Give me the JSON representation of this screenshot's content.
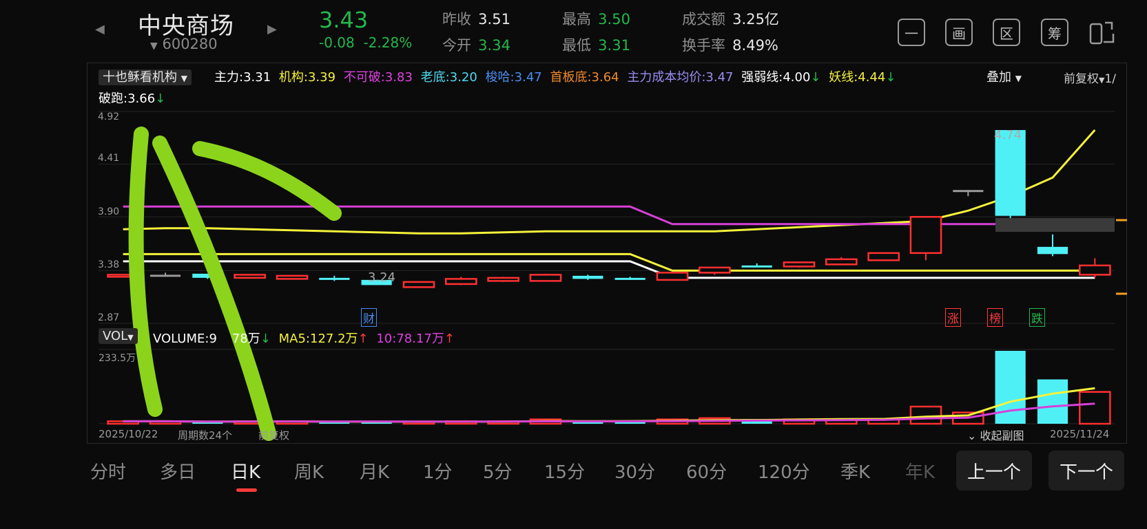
{
  "header": {
    "name": "中央商场",
    "code": "600280",
    "price": "3.43",
    "change": "-0.08",
    "change_pct": "-2.28%",
    "stats": [
      {
        "label": "昨收",
        "value": "3.51",
        "tone": "w"
      },
      {
        "label": "今开",
        "value": "3.34",
        "tone": "g"
      },
      {
        "label": "最高",
        "value": "3.50",
        "tone": "g"
      },
      {
        "label": "最低",
        "value": "3.31",
        "tone": "g"
      },
      {
        "label": "成交额",
        "value": "3.25亿",
        "tone": "w"
      },
      {
        "label": "换手率",
        "value": "8.49%",
        "tone": "w"
      }
    ],
    "tools": [
      "一",
      "画",
      "区",
      "筹"
    ]
  },
  "indicator": {
    "selector": "十也稣看机构",
    "items": [
      {
        "label": "主力:",
        "value": "3.31",
        "color": "#ffffff"
      },
      {
        "label": "机构:",
        "value": "3.39",
        "color": "#f5f23a"
      },
      {
        "label": "不可破:",
        "value": "3.83",
        "color": "#e040e0"
      },
      {
        "label": "老底:",
        "value": "3.20",
        "color": "#4fd9f0"
      },
      {
        "label": "梭哈:",
        "value": "3.47",
        "color": "#4b8df0"
      },
      {
        "label": "首板底:",
        "value": "3.64",
        "color": "#f08a2a"
      },
      {
        "label": "主力成本均价:",
        "value": "3.47",
        "color": "#9a8cf0"
      },
      {
        "label": "强弱线:",
        "value": "4.00",
        "color": "#ffffff"
      },
      {
        "label": "妖线:",
        "value": "4.44",
        "color": "#f5f23a"
      }
    ],
    "line2_label": "破跑:",
    "line2_value": "3.66",
    "overlay": "叠加",
    "adjust": "前复权",
    "page": "1/"
  },
  "price_axis": [
    "4.92",
    "4.41",
    "3.90",
    "3.38",
    "2.87"
  ],
  "annotations": {
    "low": "3.24",
    "high": "4.74",
    "fin": "财",
    "zt": "涨",
    "bang": "榜",
    "die": "跌"
  },
  "volume": {
    "selector": "VOL",
    "label": "VOLUME:",
    "value": "9",
    "value_suffix": "78万",
    "ma5": "MA5:127.2万",
    "ma10": "10:78.17万",
    "axis_top": "233.5万"
  },
  "footer": {
    "start": "2025/10/22",
    "periods": "周期数24个",
    "adjust": "前复权",
    "collapse": "收起副图",
    "end": "2025/11/24"
  },
  "tabs": [
    "分时",
    "多日",
    "日K",
    "周K",
    "月K",
    "1分",
    "5分",
    "15分",
    "30分",
    "60分",
    "120分",
    "季K",
    "年K"
  ],
  "active_tab": "日K",
  "nav": {
    "prev": "上一个",
    "next": "下一个"
  },
  "chart_data": {
    "type": "candlestick",
    "dates": [
      "2025/10/22",
      "",
      "",
      "",
      "",
      "",
      "",
      "",
      "",
      "",
      "",
      "",
      "",
      "",
      "",
      "",
      "",
      "",
      "",
      "",
      "",
      "",
      "",
      "2025/11/24"
    ],
    "candles": [
      {
        "o": 3.34,
        "c": 3.34,
        "h": 3.34,
        "l": 3.34,
        "dir": "up"
      },
      {
        "o": 3.34,
        "c": 3.34,
        "h": 3.36,
        "l": 3.32,
        "dir": "flat"
      },
      {
        "o": 3.35,
        "c": 3.31,
        "h": 3.35,
        "l": 3.3,
        "dir": "down"
      },
      {
        "o": 3.31,
        "c": 3.34,
        "h": 3.34,
        "l": 3.31,
        "dir": "up"
      },
      {
        "o": 3.3,
        "c": 3.33,
        "h": 3.33,
        "l": 3.3,
        "dir": "up"
      },
      {
        "o": 3.31,
        "c": 3.3,
        "h": 3.33,
        "l": 3.28,
        "dir": "down"
      },
      {
        "o": 3.29,
        "c": 3.24,
        "h": 3.29,
        "l": 3.24,
        "dir": "down"
      },
      {
        "o": 3.22,
        "c": 3.27,
        "h": 3.27,
        "l": 3.22,
        "dir": "up"
      },
      {
        "o": 3.25,
        "c": 3.3,
        "h": 3.32,
        "l": 3.24,
        "dir": "up"
      },
      {
        "o": 3.28,
        "c": 3.31,
        "h": 3.32,
        "l": 3.27,
        "dir": "up"
      },
      {
        "o": 3.28,
        "c": 3.34,
        "h": 3.35,
        "l": 3.28,
        "dir": "up"
      },
      {
        "o": 3.33,
        "c": 3.3,
        "h": 3.34,
        "l": 3.29,
        "dir": "down"
      },
      {
        "o": 3.31,
        "c": 3.3,
        "h": 3.32,
        "l": 3.29,
        "dir": "down"
      },
      {
        "o": 3.29,
        "c": 3.36,
        "h": 3.36,
        "l": 3.29,
        "dir": "up"
      },
      {
        "o": 3.36,
        "c": 3.41,
        "h": 3.41,
        "l": 3.34,
        "dir": "up"
      },
      {
        "o": 3.42,
        "c": 3.43,
        "h": 3.45,
        "l": 3.41,
        "dir": "down"
      },
      {
        "o": 3.42,
        "c": 3.46,
        "h": 3.46,
        "l": 3.41,
        "dir": "up"
      },
      {
        "o": 3.44,
        "c": 3.49,
        "h": 3.51,
        "l": 3.44,
        "dir": "up"
      },
      {
        "o": 3.48,
        "c": 3.55,
        "h": 3.55,
        "l": 3.48,
        "dir": "up"
      },
      {
        "o": 3.55,
        "c": 3.9,
        "h": 3.9,
        "l": 3.48,
        "dir": "up"
      },
      {
        "o": 4.16,
        "c": 4.16,
        "h": 4.16,
        "l": 4.1,
        "dir": "flat"
      },
      {
        "o": 4.74,
        "c": 3.91,
        "h": 4.74,
        "l": 3.88,
        "dir": "down"
      },
      {
        "o": 3.61,
        "c": 3.54,
        "h": 3.73,
        "l": 3.52,
        "dir": "down"
      },
      {
        "o": 3.34,
        "c": 3.43,
        "h": 3.5,
        "l": 3.31,
        "dir": "up"
      }
    ],
    "volume": [
      8,
      8,
      5,
      8,
      8,
      5,
      8,
      5,
      8,
      8,
      14,
      6,
      6,
      14,
      18,
      15,
      14,
      14,
      15,
      55,
      36,
      233.5,
      142,
      102
    ],
    "ylim": [
      2.87,
      4.92
    ],
    "lines": {
      "机构": [
        3.78,
        3.79,
        3.79,
        3.78,
        3.77,
        3.76,
        3.75,
        3.74,
        3.74,
        3.75,
        3.76,
        3.76,
        3.76,
        3.76,
        3.76,
        3.78,
        3.8,
        3.82,
        3.84,
        3.86,
        3.96,
        4.1,
        4.28,
        4.74
      ],
      "不可破": [
        4.0,
        4.0,
        4.0,
        4.0,
        4.0,
        4.0,
        4.0,
        4.0,
        4.0,
        4.0,
        4.0,
        4.0,
        4.0,
        3.83,
        3.83,
        3.83,
        3.83,
        3.83,
        3.83,
        3.83,
        3.83,
        3.83,
        3.83,
        3.83
      ],
      "妖线": [
        3.54,
        3.54,
        3.54,
        3.54,
        3.54,
        3.54,
        3.54,
        3.54,
        3.54,
        3.54,
        3.54,
        3.54,
        3.54,
        3.38,
        3.38,
        3.38,
        3.38,
        3.38,
        3.38,
        3.38,
        3.38,
        3.38,
        3.38,
        3.38
      ],
      "主力": [
        3.47,
        3.47,
        3.47,
        3.47,
        3.47,
        3.47,
        3.47,
        3.47,
        3.47,
        3.47,
        3.47,
        3.47,
        3.47,
        3.31,
        3.31,
        3.31,
        3.31,
        3.31,
        3.31,
        3.31,
        3.31,
        3.31,
        3.31,
        3.31
      ]
    }
  }
}
